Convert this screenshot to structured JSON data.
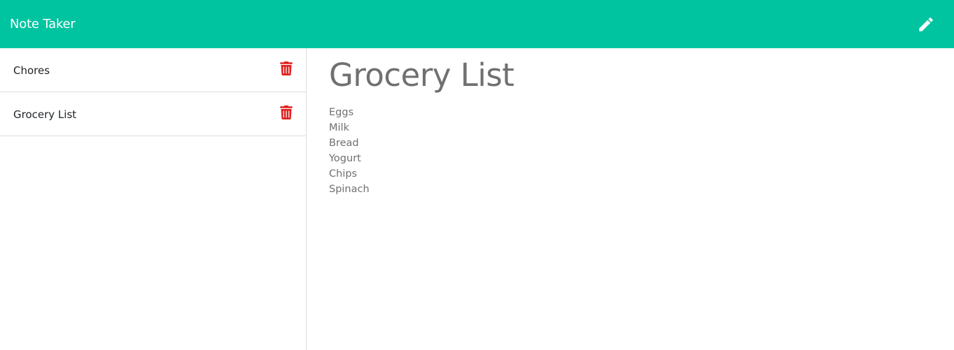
{
  "app": {
    "title": "Note Taker"
  },
  "navbar": {
    "edit_icon": "pencil-icon"
  },
  "notes": [
    {
      "title": "Chores",
      "delete_icon": "trash-icon"
    },
    {
      "title": "Grocery List",
      "delete_icon": "trash-icon"
    }
  ],
  "active_note": {
    "title": "Grocery List",
    "body": "Eggs\nMilk\nBread\nYogurt\nChips\nSpinach"
  },
  "colors": {
    "navbar": "#00c4a0",
    "delete": "#e02020",
    "text_muted": "#707070"
  }
}
